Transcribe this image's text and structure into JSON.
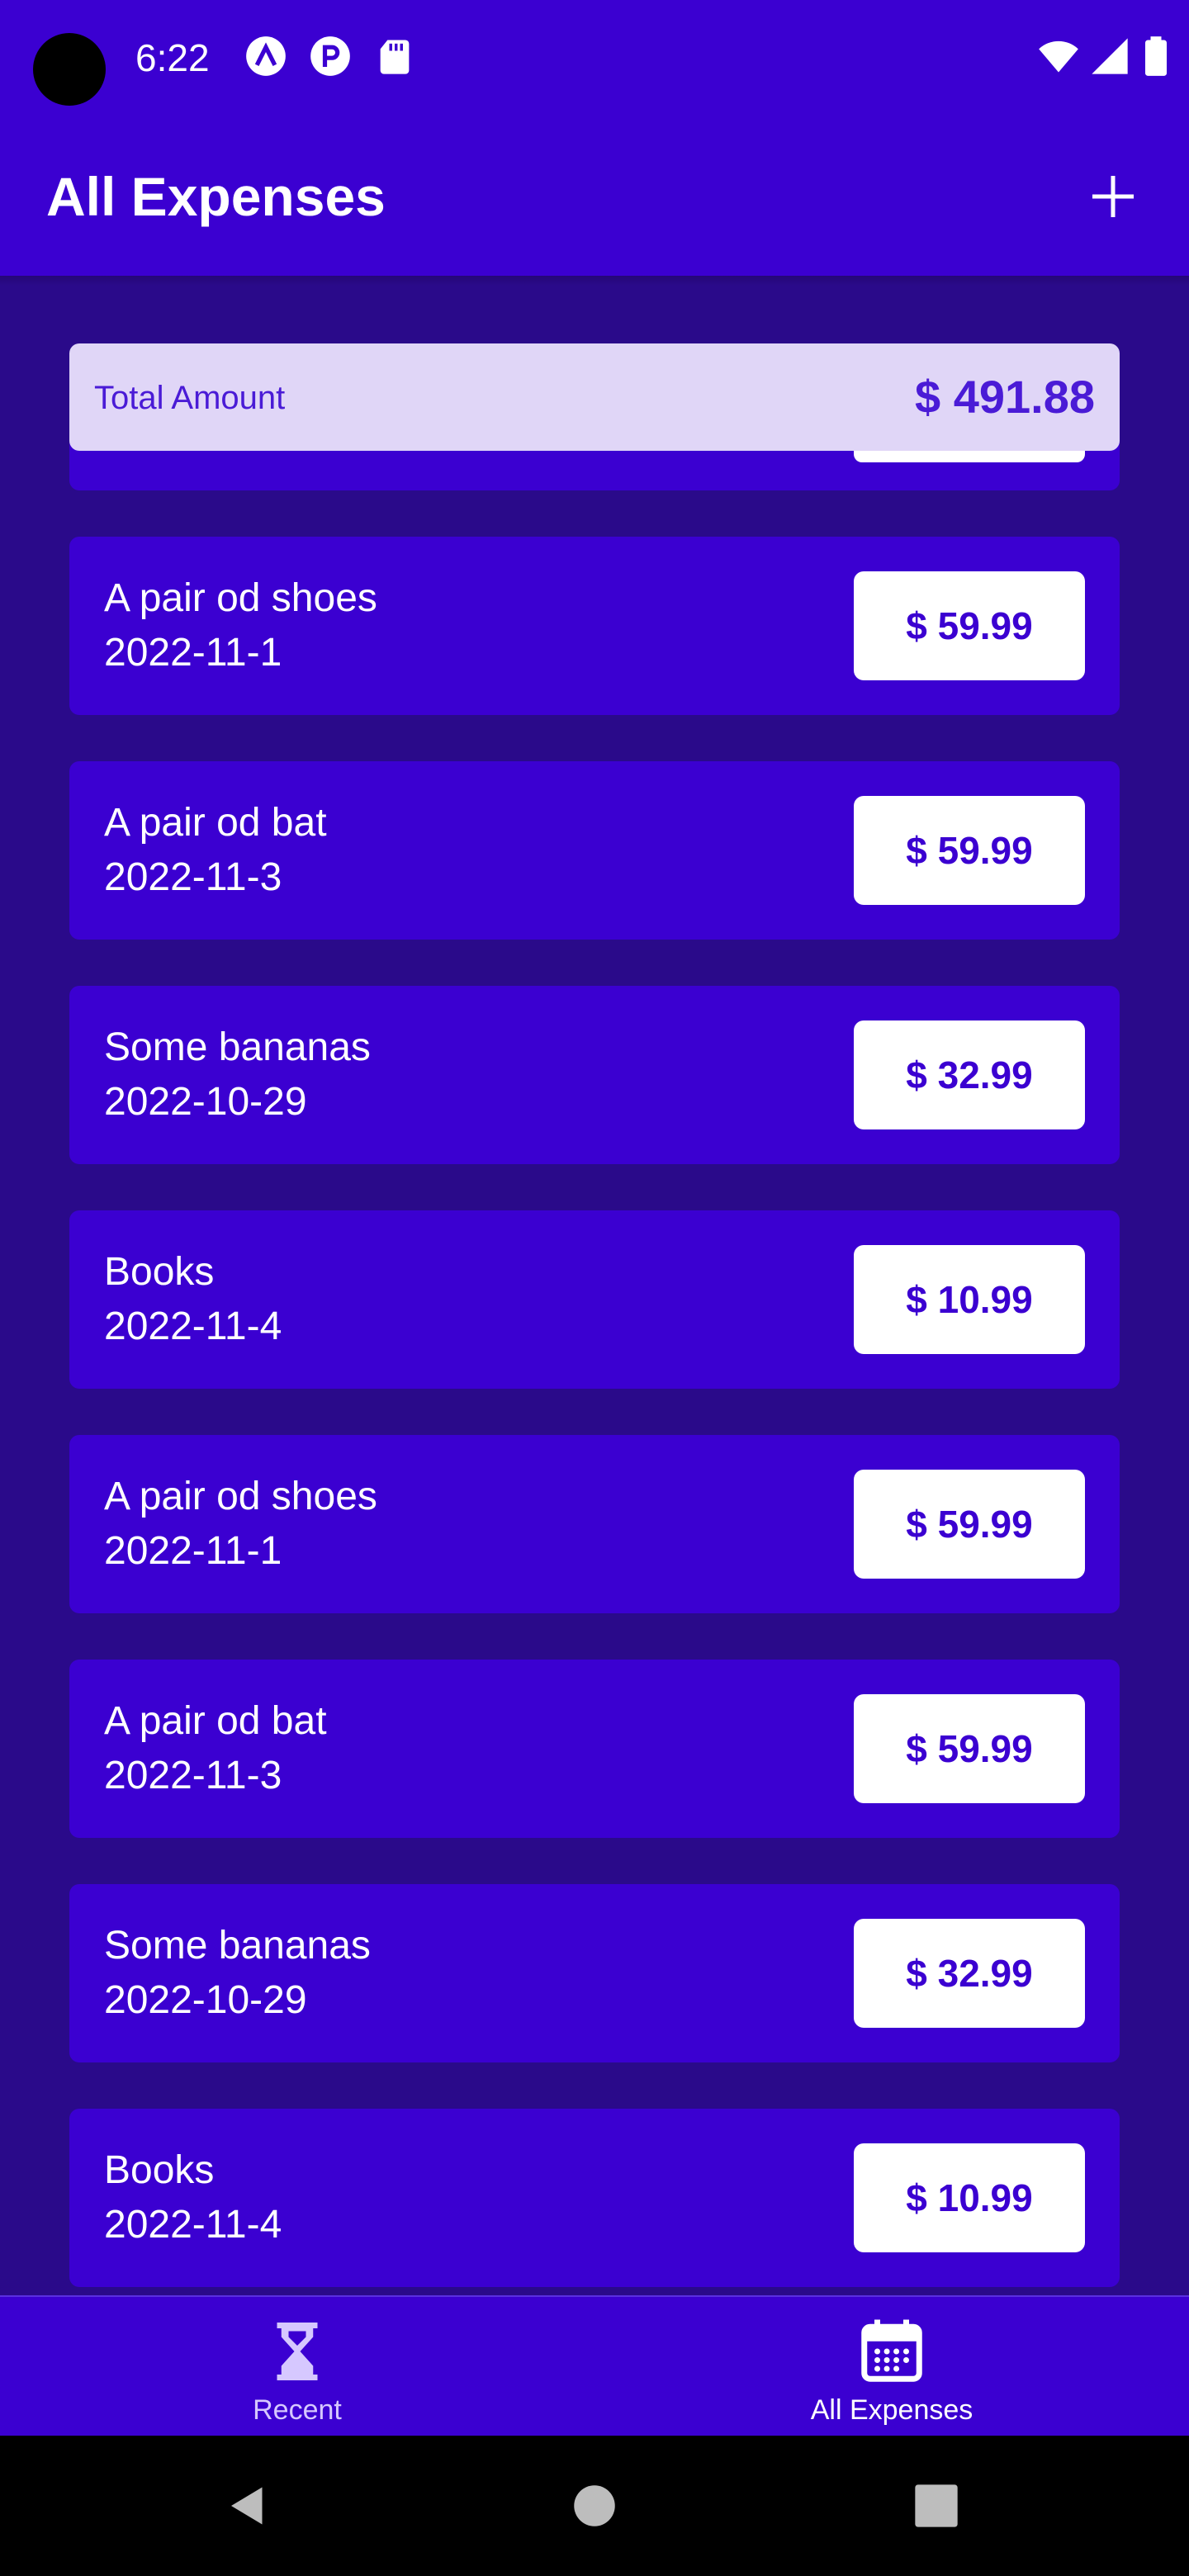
{
  "status_bar": {
    "time": "6:22"
  },
  "header": {
    "title": "All Expenses"
  },
  "summary": {
    "label": "Total Amount",
    "value": "$ 491.88"
  },
  "expenses": [
    {
      "title": "A pair od shoes",
      "date": "2022-11-1",
      "amount": "$ 59.99"
    },
    {
      "title": "A pair od bat",
      "date": "2022-11-3",
      "amount": "$ 59.99"
    },
    {
      "title": "Some bananas",
      "date": "2022-10-29",
      "amount": "$ 32.99"
    },
    {
      "title": "Books",
      "date": "2022-11-4",
      "amount": "$ 10.99"
    },
    {
      "title": "A pair od shoes",
      "date": "2022-11-1",
      "amount": "$ 59.99"
    },
    {
      "title": "A pair od bat",
      "date": "2022-11-3",
      "amount": "$ 59.99"
    },
    {
      "title": "Some bananas",
      "date": "2022-10-29",
      "amount": "$ 32.99"
    },
    {
      "title": "Books",
      "date": "2022-11-4",
      "amount": "$ 10.99"
    }
  ],
  "bottom_nav": {
    "items": [
      {
        "label": "Recent",
        "icon": "hourglass-icon",
        "active": false
      },
      {
        "label": "All Expenses",
        "icon": "calendar-icon",
        "active": true
      }
    ]
  },
  "colors": {
    "primary": "#3b00d1",
    "background": "#2a0a8a",
    "summary_bg": "#e0d6f7",
    "accent_text": "#4a1bd6",
    "inactive_nav": "#d6c8ff"
  }
}
